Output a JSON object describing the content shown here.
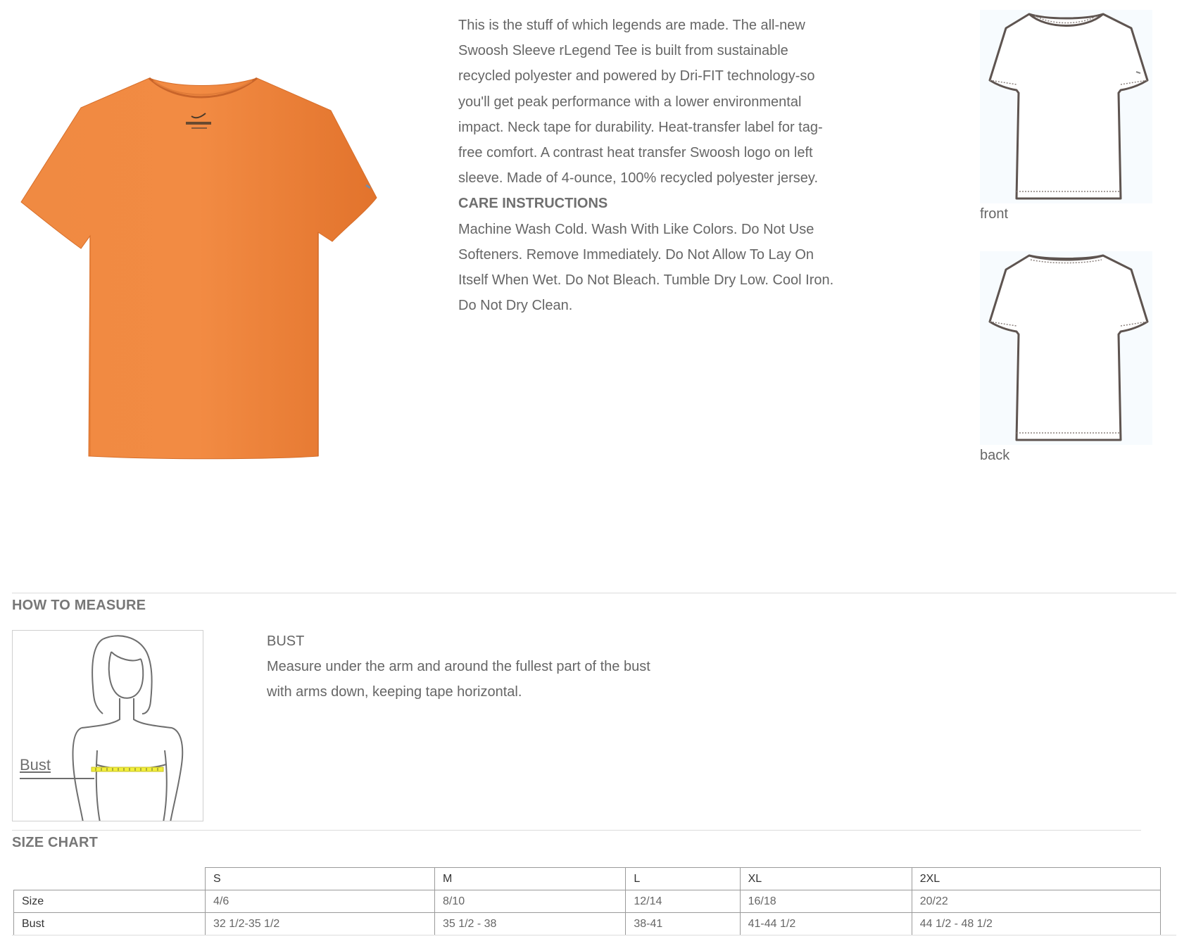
{
  "product": {
    "image_icon": "orange-tshirt-image",
    "color": "#f0843a",
    "description": "This is the stuff of which legends are made. The all-new Swoosh Sleeve rLegend Tee is built from sustainable recycled polyester and powered by Dri-FIT technology-so you'll get peak performance with a lower environmental impact. Neck tape for durability. Heat-transfer label for tag-free comfort. A contrast heat transfer Swoosh logo on left sleeve. Made of 4-ounce, 100% recycled polyester jersey.",
    "care_title": "CARE INSTRUCTIONS",
    "care_text": "Machine Wash Cold. Wash With Like Colors. Do Not Use Softeners. Remove Immediately. Do Not Allow To Lay On Itself When Wet. Do Not Bleach. Tumble Dry Low. Cool Iron. Do Not Dry Clean."
  },
  "flats": {
    "front_label": "front",
    "back_label": "back"
  },
  "how_to_measure": {
    "title": "HOW TO MEASURE",
    "figure_label": "Bust",
    "measure_title": "BUST",
    "measure_text": "Measure under the arm and around the fullest part of the bust with arms down, keeping tape horizontal."
  },
  "size_chart": {
    "title": "SIZE CHART",
    "columns": [
      "S",
      "M",
      "L",
      "XL",
      "2XL"
    ],
    "rows": [
      {
        "label": "Size",
        "values": [
          "4/6",
          "8/10",
          "12/14",
          "16/18",
          "20/22"
        ]
      },
      {
        "label": "Bust",
        "values": [
          "32 1/2-35 1/2",
          "35 1/2 - 38",
          "38-41",
          "41-44 1/2",
          "44 1/2 - 48 1/2"
        ]
      }
    ]
  }
}
